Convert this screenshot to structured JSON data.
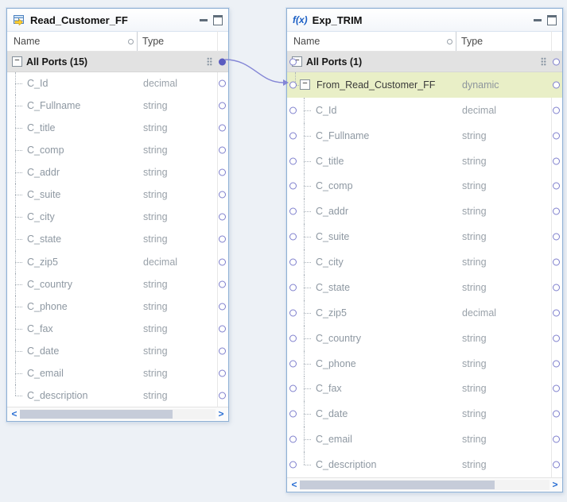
{
  "canvas": {
    "background": "#edf1f6"
  },
  "connector": {
    "color": "#8486d6"
  },
  "columns": {
    "name": "Name",
    "type": "Type"
  },
  "glyphs": {
    "expander": "−",
    "scroll_left": "<",
    "scroll_right": ">",
    "fx": "f(x)"
  },
  "left_box": {
    "title": "Read_Customer_FF",
    "group_label": "All Ports (15)",
    "ports": [
      {
        "name": "C_Id",
        "type": "decimal"
      },
      {
        "name": "C_Fullname",
        "type": "string"
      },
      {
        "name": "C_title",
        "type": "string"
      },
      {
        "name": "C_comp",
        "type": "string"
      },
      {
        "name": "C_addr",
        "type": "string"
      },
      {
        "name": "C_suite",
        "type": "string"
      },
      {
        "name": "C_city",
        "type": "string"
      },
      {
        "name": "C_state",
        "type": "string"
      },
      {
        "name": "C_zip5",
        "type": "decimal"
      },
      {
        "name": "C_country",
        "type": "string"
      },
      {
        "name": "C_phone",
        "type": "string"
      },
      {
        "name": "C_fax",
        "type": "string"
      },
      {
        "name": "C_date",
        "type": "string"
      },
      {
        "name": "C_email",
        "type": "string"
      },
      {
        "name": "C_description",
        "type": "string"
      }
    ]
  },
  "right_box": {
    "title": "Exp_TRIM",
    "group_label": "All Ports (1)",
    "dynamic_port": {
      "name": "From_Read_Customer_FF",
      "type": "dynamic"
    },
    "ports": [
      {
        "name": "C_Id",
        "type": "decimal"
      },
      {
        "name": "C_Fullname",
        "type": "string"
      },
      {
        "name": "C_title",
        "type": "string"
      },
      {
        "name": "C_comp",
        "type": "string"
      },
      {
        "name": "C_addr",
        "type": "string"
      },
      {
        "name": "C_suite",
        "type": "string"
      },
      {
        "name": "C_city",
        "type": "string"
      },
      {
        "name": "C_state",
        "type": "string"
      },
      {
        "name": "C_zip5",
        "type": "decimal"
      },
      {
        "name": "C_country",
        "type": "string"
      },
      {
        "name": "C_phone",
        "type": "string"
      },
      {
        "name": "C_fax",
        "type": "string"
      },
      {
        "name": "C_date",
        "type": "string"
      },
      {
        "name": "C_email",
        "type": "string"
      },
      {
        "name": "C_description",
        "type": "string"
      }
    ]
  }
}
